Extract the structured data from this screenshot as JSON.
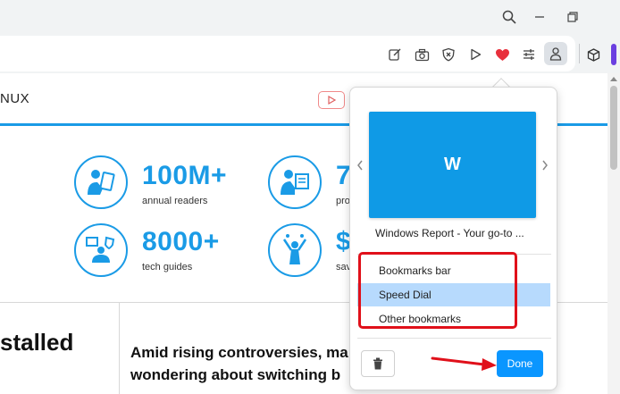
{
  "window_controls": {
    "search_icon": "search-icon",
    "minimize_icon": "minimize-icon",
    "restore_icon": "restore-icon"
  },
  "toolbar": {
    "icons": [
      "edit-icon",
      "camera-icon",
      "shield-x-icon",
      "play-icon",
      "heart-icon",
      "settings-sliders-icon",
      "profile-icon",
      "cube-icon"
    ],
    "heart_color": "#e8303c"
  },
  "site": {
    "nav_text": "NUX",
    "stats": [
      {
        "value": "100M+",
        "label": "annual readers"
      },
      {
        "value": "7",
        "label": "pro"
      },
      {
        "value": "8000+",
        "label": "tech guides"
      },
      {
        "value": "$",
        "label": "sav"
      }
    ],
    "left_heading": "stalled",
    "article_lines": [
      "Amid rising controversies, ma",
      "wondering about switching b"
    ],
    "accent_color": "#1a9be6"
  },
  "bookmark_popup": {
    "thumbnail_letter": "W",
    "page_title": "Windows Report - Your go-to ...",
    "folders": [
      {
        "label": "Bookmarks bar",
        "selected": false
      },
      {
        "label": "Speed Dial",
        "selected": true
      },
      {
        "label": "Other bookmarks",
        "selected": false
      }
    ],
    "done_label": "Done",
    "annotation_color": "#e0101a"
  }
}
